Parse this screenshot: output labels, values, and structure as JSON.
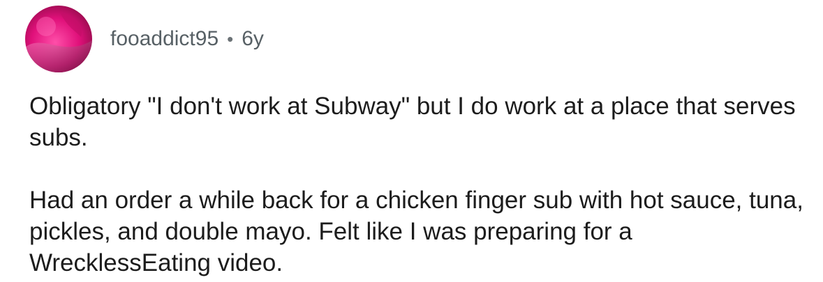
{
  "comment": {
    "author": {
      "username": "fooaddict95",
      "avatar_icon": "user-avatar-icon",
      "avatar_colors": [
        "#e0107a",
        "#ff3fa3",
        "#7a0a3f"
      ]
    },
    "separator": "•",
    "age": "6y",
    "paragraphs": [
      "Obligatory \"I don't work at Subway\" but I do work at a place that serves subs.",
      "Had an order a while back for a chicken finger sub with hot sauce, tuna, pickles, and double mayo. Felt like I was preparing for a WrecklessEating video."
    ]
  }
}
